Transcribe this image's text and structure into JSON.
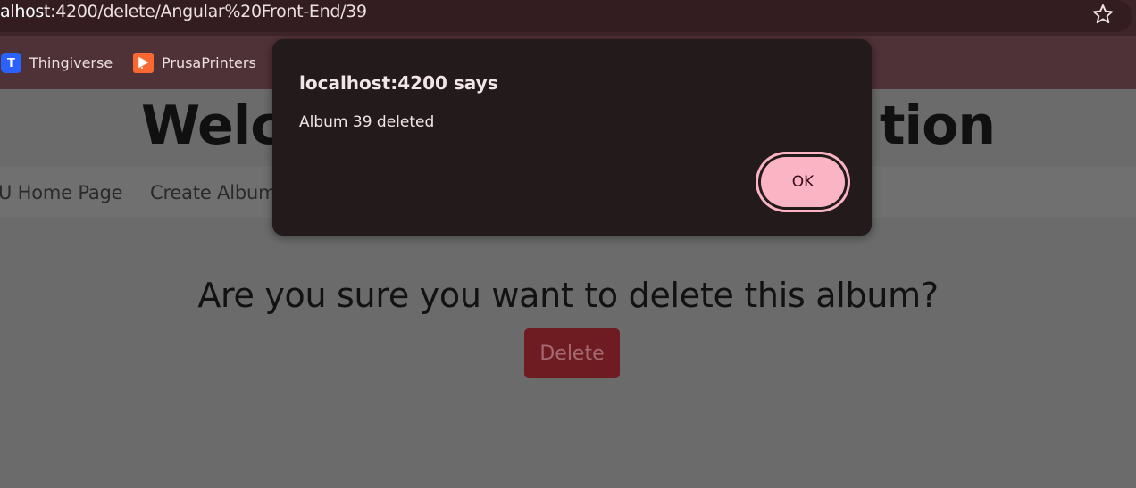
{
  "browser": {
    "url_host": "alhost",
    "url_rest": ":4200/delete/Angular%20Front-End/39",
    "star_icon": "star-outline-icon",
    "bookmarks": [
      {
        "label": "Thingiverse",
        "icon": "thingiverse-favicon"
      },
      {
        "label": "PrusaPrinters",
        "icon": "prusaprinters-favicon"
      }
    ]
  },
  "page": {
    "title_left": "Welc",
    "title_right": "tion",
    "nav": {
      "home_label": "U Home Page",
      "create_label": "Create Album"
    },
    "confirm_heading": "Are you sure you want to delete this album?",
    "delete_label": "Delete"
  },
  "dialog": {
    "title": "localhost:4200 says",
    "message": "Album 39 deleted",
    "ok_label": "OK"
  },
  "colors": {
    "chrome_dark": "#331d21",
    "bookmarks_bg": "#4f3238",
    "dialog_bg": "#231a1c",
    "ok_accent": "#fbb4c3",
    "delete_button": "#6e1b22",
    "overlay_page": "#6b6b6b"
  }
}
